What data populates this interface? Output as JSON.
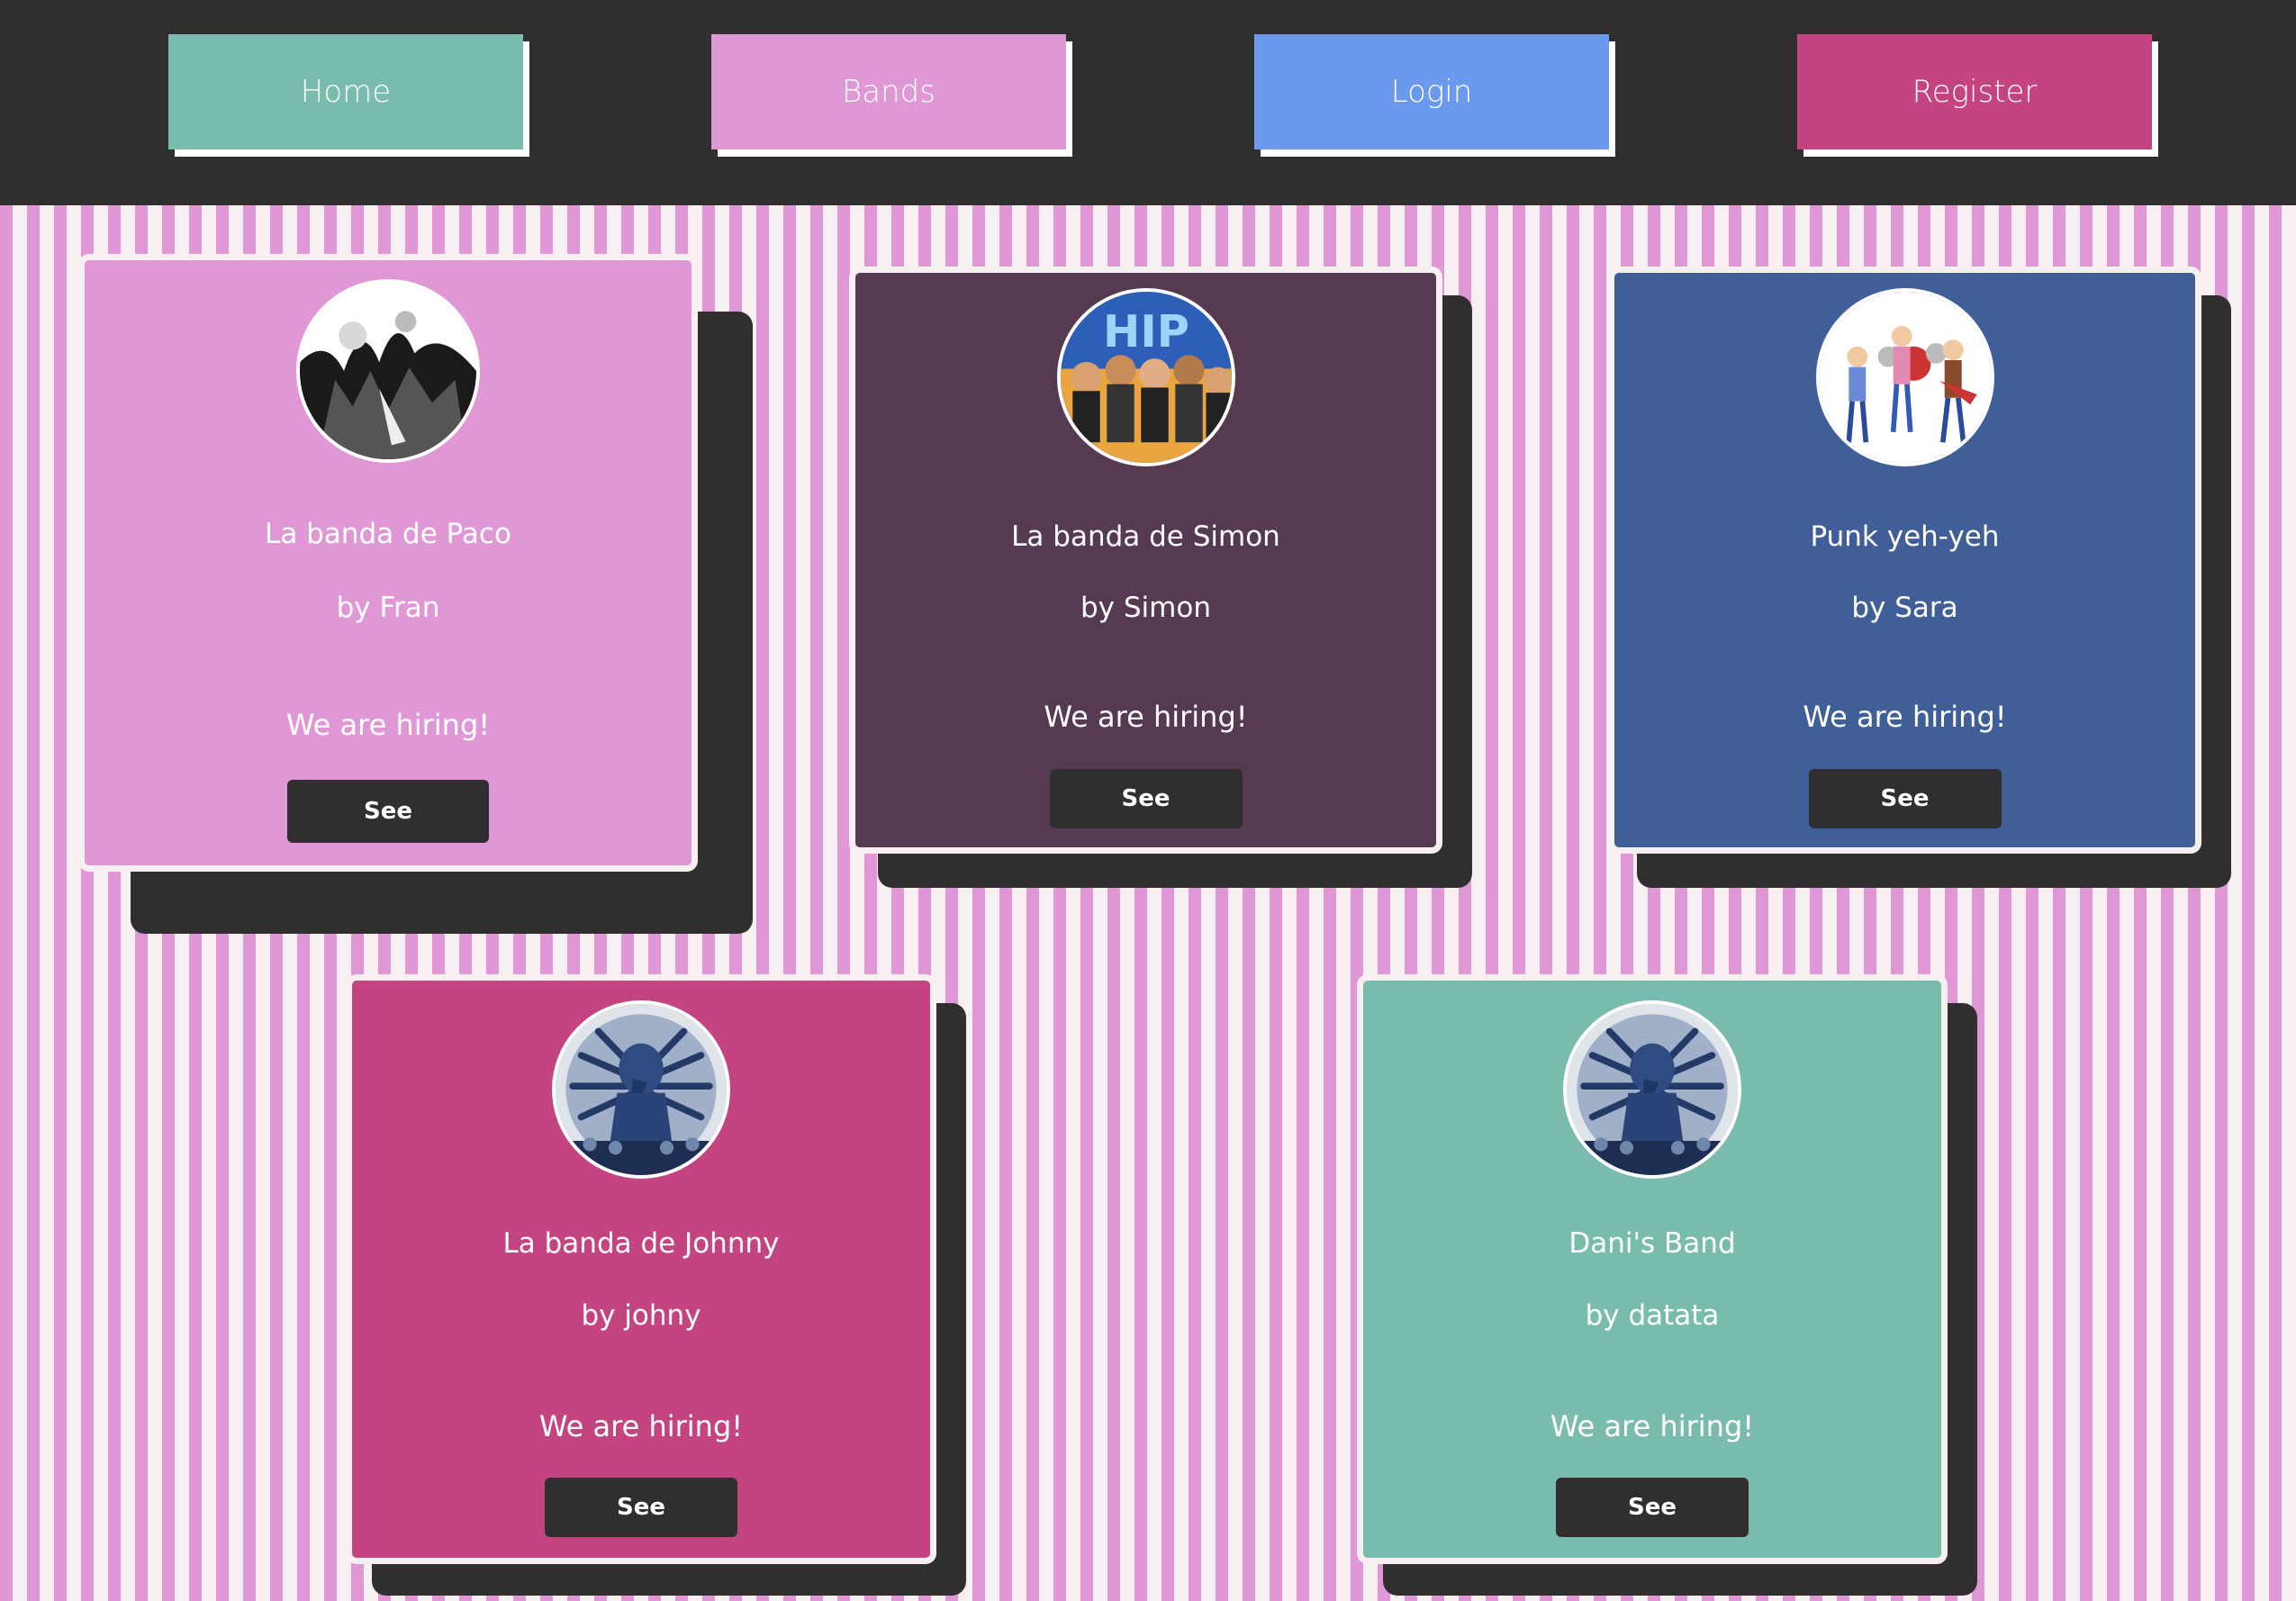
{
  "nav": {
    "home": "Home",
    "bands": "Bands",
    "login": "Login",
    "register": "Register"
  },
  "colors": {
    "topbar": "#312e2f",
    "nav_home": "#79bcae",
    "nav_bands": "#df98d5",
    "nav_login": "#6a99ed",
    "nav_register": "#c44381",
    "stripe_pink": "#df98d5",
    "stripe_light": "#f7eff0"
  },
  "bands": [
    {
      "name": "La banda de Paco",
      "owner": "by Fran",
      "status": "We are hiring!",
      "button": "See",
      "card_color": "#df98d5",
      "avatar": "concert-photo-icon"
    },
    {
      "name": "La banda de Simon",
      "owner": "by Simon",
      "status": "We are hiring!",
      "button": "See",
      "card_color": "#553a52",
      "avatar": "hiphop-crew-icon"
    },
    {
      "name": "Punk yeh-yeh",
      "owner": "by Sara",
      "status": "We are hiring!",
      "button": "See",
      "card_color": "#405e98",
      "avatar": "cartoon-band-icon"
    },
    {
      "name": "La banda de Johnny",
      "owner": "by johny",
      "status": "We are hiring!",
      "button": "See",
      "card_color": "#c44381",
      "avatar": "deity-illustration-icon"
    },
    {
      "name": "Dani's Band",
      "owner": "by datata",
      "status": "We are hiring!",
      "button": "See",
      "card_color": "#79bcae",
      "avatar": "deity-illustration-icon"
    }
  ]
}
